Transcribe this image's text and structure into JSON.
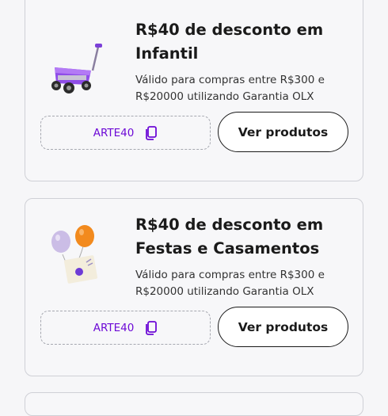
{
  "offers": [
    {
      "title": "R$40 de desconto em Infantil",
      "description": "Válido para compras entre R$300 e R$20000 utilizando Garantia OLX",
      "coupon_code": "ARTE40",
      "button_label": "Ver produtos",
      "image": "toy-wagon-image"
    },
    {
      "title": "R$40 de desconto em Festas e Casamentos",
      "description": "Válido para compras entre R$300 e R$20000 utilizando Garantia OLX",
      "coupon_code": "ARTE40",
      "button_label": "Ver produtos",
      "image": "balloons-invitation-image"
    }
  ],
  "colors": {
    "accent": "#6d0ad6",
    "text": "#1a1a1a",
    "card_border": "#cfd0d6"
  },
  "icons": {
    "copy": "copy-icon"
  }
}
